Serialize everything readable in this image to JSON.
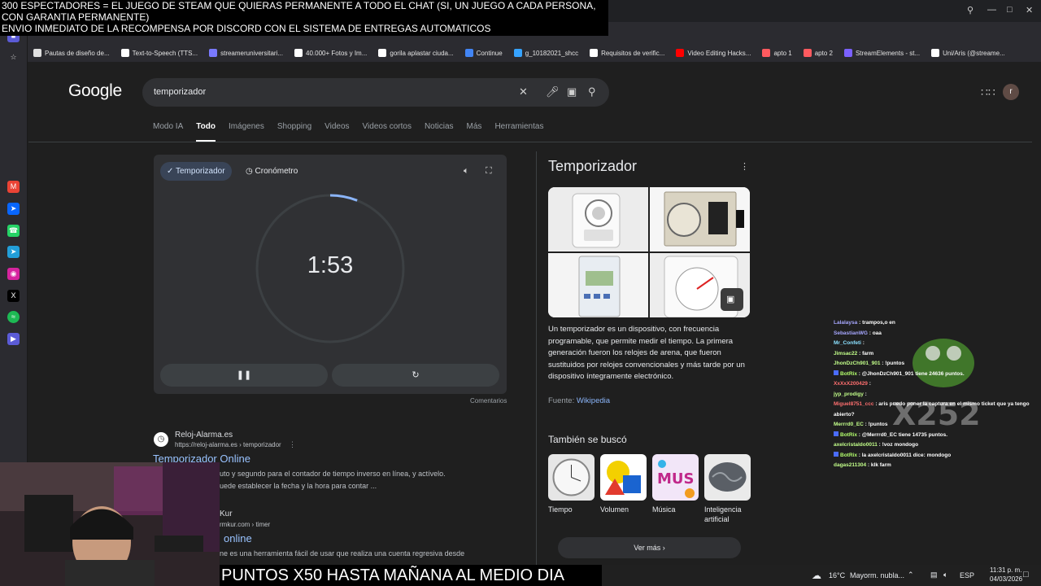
{
  "overlay": {
    "line1": "300 ESPECTADORES = EL JUEGO DE STEAM QUE QUIERAS PERMANENTE A TODO EL CHAT (SI, UN JUEGO A CADA PERSONA,",
    "line2": "CON GARANTIA PERMANENTE)",
    "line3": "ENVIO INMEDIATO DE LA RECOMPENSA POR DISCORD CON EL SISTEMA DE ENTREGAS AUTOMATICOS",
    "bottom": "PUNTOS X50 HASTA MAÑANA AL MEDIO DIA"
  },
  "bookmarks": [
    {
      "label": "Pautas de diseño de...",
      "icon": "doc-icon",
      "color": "#e0e0e0"
    },
    {
      "label": "Text-to-Speech (TTS...",
      "icon": "tts-icon",
      "color": "#ffffff"
    },
    {
      "label": "streameruniversitari...",
      "icon": "folder-icon",
      "color": "#7a7aff"
    },
    {
      "label": "40.000+ Fotos y Im...",
      "icon": "pexels-icon",
      "color": "#ffffff"
    },
    {
      "label": "gorila aplastar ciuda...",
      "icon": "google-icon",
      "color": "#ffffff"
    },
    {
      "label": "Continue",
      "icon": "drive-icon",
      "color": "#4285f4"
    },
    {
      "label": "g_10182021_shcc",
      "icon": "edge-icon",
      "color": "#36a3ff"
    },
    {
      "label": "Requisitos de verific...",
      "icon": "x-icon",
      "color": "#ffffff"
    },
    {
      "label": "Video Editing Hacks...",
      "icon": "youtube-icon",
      "color": "#ff0000"
    },
    {
      "label": "apto 1",
      "icon": "airbnb-icon",
      "color": "#ff5a5f"
    },
    {
      "label": "apto 2",
      "icon": "airbnb-icon",
      "color": "#ff5a5f"
    },
    {
      "label": "StreamElements - st...",
      "icon": "streamelements-icon",
      "color": "#7b61ff"
    },
    {
      "label": "Uni/Aris (@streame...",
      "icon": "tiktok-icon",
      "color": "#ffffff"
    }
  ],
  "google": {
    "logo": "Google",
    "query": "temporizador",
    "tabs": [
      "Modo IA",
      "Todo",
      "Imágenes",
      "Shopping",
      "Videos",
      "Videos cortos",
      "Noticias",
      "Más",
      "Herramientas"
    ],
    "active_tab": "Todo",
    "avatar_letter": "r"
  },
  "timer": {
    "tab_timer": "Temporizador",
    "tab_stopwatch": "Cronómetro",
    "value": "1:53",
    "progress": 0.06,
    "comments": "Comentarios"
  },
  "results": [
    {
      "site": "Reloj-Alarma.es",
      "url": "https://reloj-alarma.es › temporizador",
      "title": "Temporizador Online",
      "snippet1": "uto y segundo para el contador de tiempo inverso en línea, y actívelo.",
      "snippet2": "uede establecer la fecha y la hora para contar ..."
    },
    {
      "site": "Kur",
      "url": "rmkur.com › timer",
      "title": "online",
      "snippet1": "ne es una herramienta fácil de usar que realiza una cuenta regresiva desde",
      "snippet2": ""
    }
  ],
  "knowledge": {
    "title": "Temporizador",
    "description": "Un temporizador es un dispositivo, con frecuencia programable, que permite medir el tiempo. La primera generación fueron los relojes de arena, que fueron sustituidos por relojes convencionales y más tarde por un dispositivo íntegramente electrónico.",
    "source_label": "Fuente:",
    "source": "Wikipedia",
    "also_searched": "También se buscó",
    "related": [
      "Tiempo",
      "Volumen",
      "Música",
      "Inteligencia artificial"
    ],
    "more": "Ver más"
  },
  "chat": [
    {
      "user": "Lalalaysa",
      "msg": "trampos,o en",
      "cls": "u-a",
      "bot": false
    },
    {
      "user": "SebastianWG",
      "msg": "oaa",
      "cls": "u-a",
      "bot": false
    },
    {
      "user": "Mr_Confeti",
      "msg": "",
      "cls": "u-d",
      "bot": false
    },
    {
      "user": "Jimsac22",
      "msg": "farm",
      "cls": "u-b",
      "bot": false
    },
    {
      "user": "JhonDzCh901_901",
      "msg": "!puntos",
      "cls": "u-b",
      "bot": false
    },
    {
      "user": "BotRix",
      "msg": "@JhonDzCh901_901 tiene 24636 puntos.",
      "cls": "u-e",
      "bot": true
    },
    {
      "user": "XxXxX200429",
      "msg": "",
      "cls": "u-c",
      "bot": false
    },
    {
      "user": "jyp_prodigy",
      "msg": "",
      "cls": "u-b",
      "bot": false
    },
    {
      "user": "Miguel8751_ccc",
      "msg": "aris puedo poner la captura en el mismo ticket que ya tengo",
      "cls": "u-c",
      "bot": false
    },
    {
      "user": "",
      "msg": "abierto?",
      "cls": "u-c",
      "bot": false
    },
    {
      "user": "Merrrd0_EC",
      "msg": "!puntos",
      "cls": "u-b",
      "bot": false
    },
    {
      "user": "BotRix",
      "msg": "@Merrrd0_EC tiene 14735 puntos.",
      "cls": "u-e",
      "bot": true
    },
    {
      "user": "axelcristaldo0011",
      "msg": "!voz mondogo",
      "cls": "u-b",
      "bot": false
    },
    {
      "user": "BotRix",
      "msg": "la axelcristaldo0011 dice: mondogo",
      "cls": "u-e",
      "bot": true
    },
    {
      "user": "dagas211304",
      "msg": "klk farm",
      "cls": "u-b",
      "bot": false
    }
  ],
  "chat_badge": "X252",
  "taskbar": {
    "weather_temp": "16°C",
    "weather_desc": "Mayorm. nubla...",
    "lang": "ESP",
    "time": "11:31 p. m.",
    "date": "04/03/2026"
  },
  "colors": {
    "accent": "#8ab4f8",
    "link": "#99c3ff",
    "panel": "#303134"
  }
}
